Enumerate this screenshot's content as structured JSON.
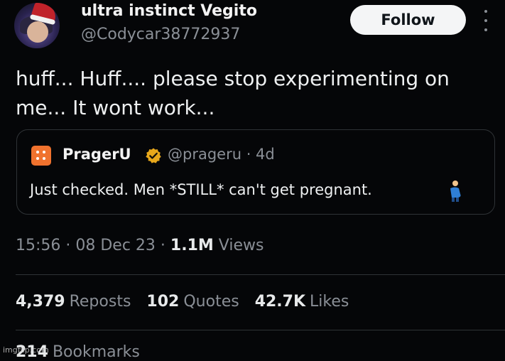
{
  "author": {
    "display_name": "ultra instinct Vegito",
    "handle": "@Codycar38772937"
  },
  "follow_label": "Follow",
  "tweet_text": "huff... Huff.... please stop experimenting on me... It wont work...",
  "quoted_tweet": {
    "name": "PragerU",
    "handle_time": "@prageru · 4d",
    "text": "Just checked. Men *STILL* can't get pregnant.",
    "emoji_icon": "pregnant-man-icon",
    "logo_color": "#f0722e",
    "verified_color": "#e8a81b"
  },
  "meta": {
    "time_date": "15:56 · 08 Dec 23 · ",
    "views_count": "1.1M",
    "views_label": "Views"
  },
  "stats": [
    {
      "value": "4,379",
      "label": "Reposts"
    },
    {
      "value": "102",
      "label": "Quotes"
    },
    {
      "value": "42.7K",
      "label": "Likes"
    }
  ],
  "bookmarks_partial": {
    "value": "214",
    "label": "Bookmarks"
  },
  "watermark": "imgflip.com",
  "colors": {
    "background": "#050608",
    "text": "#e7e9ea",
    "secondary_text": "#8a8f96",
    "border": "#2f3336"
  }
}
